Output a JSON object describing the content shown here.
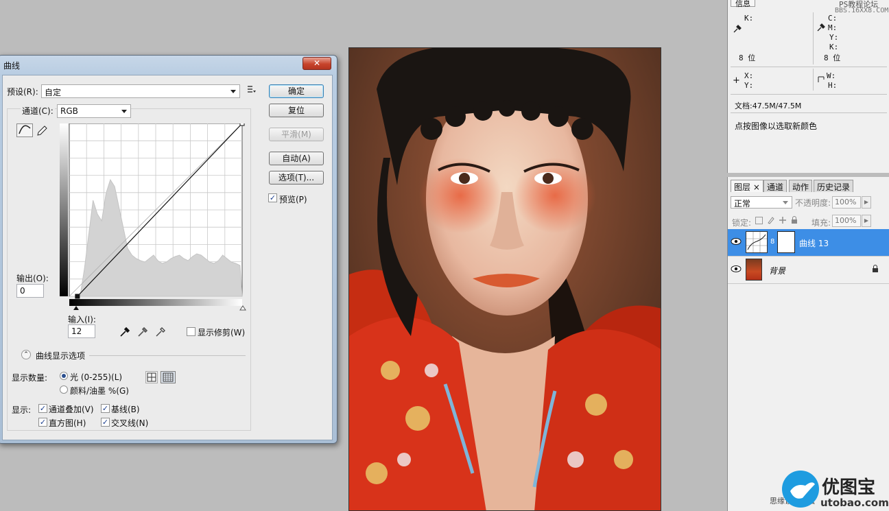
{
  "curves_dialog": {
    "title": "曲线",
    "close_label": "✕",
    "preset_label": "预设(R):",
    "preset_value": "自定",
    "channel_label": "通道(C):",
    "channel_value": "RGB",
    "buttons": {
      "ok": "确定",
      "reset": "复位",
      "smooth": "平滑(M)",
      "auto": "自动(A)",
      "options": "选项(T)..."
    },
    "preview_label": "预览(P)",
    "preview_checked": true,
    "output_label": "输出(O):",
    "output_value": "0",
    "input_label": "输入(I):",
    "input_value": "12",
    "show_clipping_label": "显示修剪(W)",
    "show_clipping_checked": false,
    "curve_display_options": "曲线显示选项",
    "show_amount_label": "显示数量:",
    "light_option": "光 (0-255)(L)",
    "pigment_option": "颜料/油墨 %(G)",
    "light_selected": true,
    "show_label": "显示:",
    "channel_overlays": "通道叠加(V)",
    "baseline": "基线(B)",
    "histogram": "直方图(H)",
    "intersection_line": "交叉线(N)"
  },
  "info_panel": {
    "tab": "信息",
    "k_label_left": "K:",
    "c_label": "C:",
    "m_label": "M:",
    "y_label": "Y:",
    "k_label_right": "K:",
    "bit_left": "8 位",
    "bit_right": "8 位",
    "x_label": "X:",
    "y_label_pos": "Y:",
    "w_label": "W:",
    "h_label": "H:",
    "doc_info": "文档:47.5M/47.5M",
    "hint": "点按图像以选取新颜色"
  },
  "layers_panel": {
    "tabs": [
      "图层",
      "通道",
      "动作",
      "历史记录"
    ],
    "tab_close": "×",
    "blend_mode": "正常",
    "opacity_label": "不透明度:",
    "opacity_value": "100%",
    "lock_label": "锁定:",
    "fill_label": "填充:",
    "fill_value": "100%",
    "layers": [
      {
        "name": "曲线 13"
      },
      {
        "name": "背景"
      }
    ]
  },
  "watermark": {
    "top_line1": "PS教程论坛",
    "top_line2": "BBS.16XX8.COM",
    "brand_cn": "优图宝",
    "brand_url": "utobao.com",
    "bottom_left_text": "思缘设计论坛"
  },
  "chart_data": {
    "type": "line",
    "title": "",
    "xlabel": "",
    "ylabel": "",
    "xlim": [
      0,
      255
    ],
    "ylim": [
      0,
      255
    ],
    "grid": true,
    "x": [
      12,
      255
    ],
    "series": [
      {
        "values": [
          0,
          255
        ]
      }
    ]
  },
  "colors": {
    "selected_layer": "#3d8ee6",
    "dialog_frame": "#b9cde2",
    "panel_bg": "#f0f0f0",
    "workspace_bg": "#bcbcbc"
  }
}
